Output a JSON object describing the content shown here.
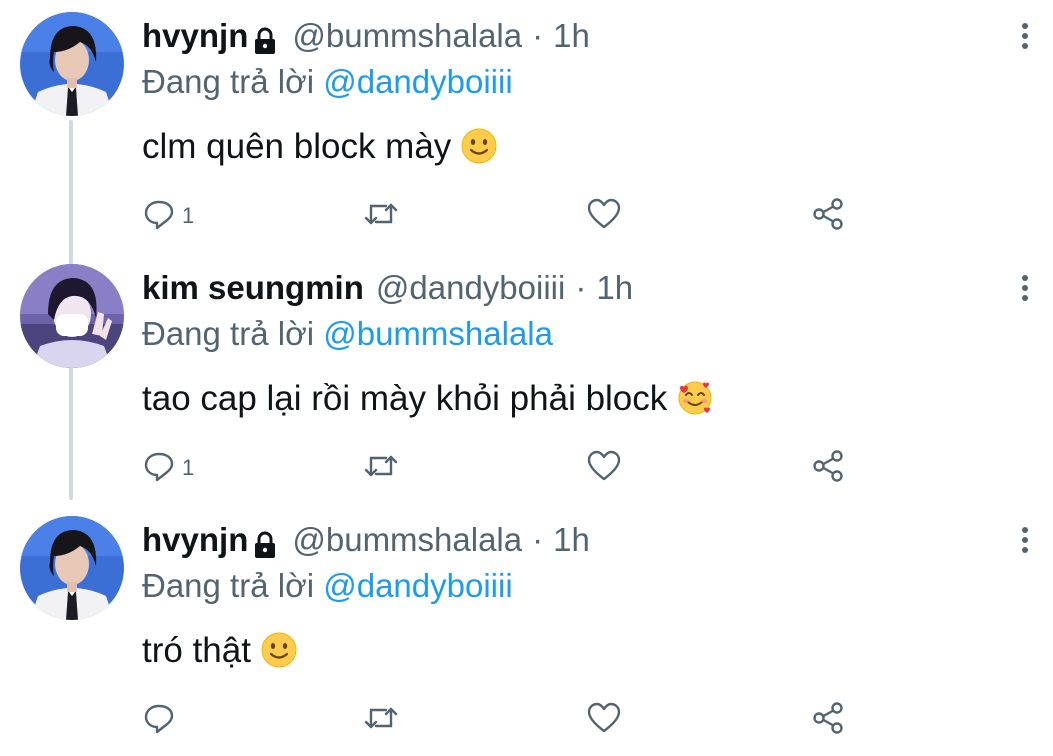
{
  "tweets": [
    {
      "name": "hvynjn",
      "protected": true,
      "handle": "@bummshalala",
      "separator": "·",
      "time": "1h",
      "replying_prefix": "Đang trả lời",
      "replying_to": "@dandyboiiii",
      "text": "clm quên block mày",
      "emoji": "slightly-smiling-face",
      "reply_count": "1",
      "avatar": "avatar-hvynjn"
    },
    {
      "name": "kim seungmin",
      "protected": false,
      "handle": "@dandyboiiii",
      "separator": "·",
      "time": "1h",
      "replying_prefix": "Đang trả lời",
      "replying_to": "@bummshalala",
      "text": "tao cap lại rồi mày khỏi phải block",
      "emoji": "smiling-face-with-hearts",
      "reply_count": "1",
      "avatar": "avatar-kim-seungmin"
    },
    {
      "name": "hvynjn",
      "protected": true,
      "handle": "@bummshalala",
      "separator": "·",
      "time": "1h",
      "replying_prefix": "Đang trả lời",
      "replying_to": "@dandyboiiii",
      "text": "tró thật",
      "emoji": "slightly-smiling-face",
      "reply_count": "",
      "avatar": "avatar-hvynjn"
    }
  ],
  "colors": {
    "text": "#0f1419",
    "secondary": "#536471",
    "link": "#1d9bf0",
    "thread_line": "#cfd9de"
  },
  "icons": [
    "lock-icon",
    "more-icon",
    "reply-icon",
    "retweet-icon",
    "like-icon",
    "share-icon"
  ]
}
